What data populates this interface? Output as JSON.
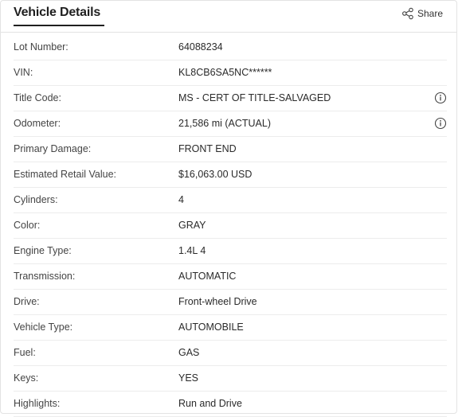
{
  "header": {
    "title": "Vehicle Details",
    "share_label": "Share"
  },
  "rows": [
    {
      "label": "Lot Number:",
      "value": "64088234",
      "info": false
    },
    {
      "label": "VIN:",
      "value": "KL8CB6SA5NC******",
      "info": false
    },
    {
      "label": "Title Code:",
      "value": "MS - CERT OF TITLE-SALVAGED",
      "info": true
    },
    {
      "label": "Odometer:",
      "value": "21,586 mi (ACTUAL)",
      "info": true
    },
    {
      "label": "Primary Damage:",
      "value": "FRONT END",
      "info": false
    },
    {
      "label": "Estimated Retail Value:",
      "value": "$16,063.00 USD",
      "info": false
    },
    {
      "label": "Cylinders:",
      "value": "4",
      "info": false
    },
    {
      "label": "Color:",
      "value": "GRAY",
      "info": false
    },
    {
      "label": "Engine Type:",
      "value": "1.4L 4",
      "info": false
    },
    {
      "label": "Transmission:",
      "value": "AUTOMATIC",
      "info": false
    },
    {
      "label": "Drive:",
      "value": "Front-wheel Drive",
      "info": false
    },
    {
      "label": "Vehicle Type:",
      "value": "AUTOMOBILE",
      "info": false
    },
    {
      "label": "Fuel:",
      "value": "GAS",
      "info": false
    },
    {
      "label": "Keys:",
      "value": "YES",
      "info": false
    },
    {
      "label": "Highlights:",
      "value": "Run and Drive",
      "info": false
    }
  ],
  "icons": {
    "share": "share-icon",
    "info": "info-icon"
  }
}
